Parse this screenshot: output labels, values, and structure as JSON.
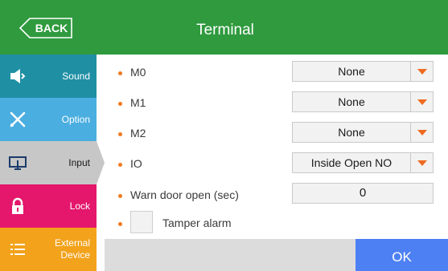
{
  "header": {
    "back_label": "BACK",
    "title": "Terminal"
  },
  "sidebar": {
    "items": [
      {
        "label": "Sound",
        "icon": "speaker-icon"
      },
      {
        "label": "Option",
        "icon": "tools-icon"
      },
      {
        "label": "Input",
        "icon": "monitor-icon",
        "selected": true
      },
      {
        "label": "Lock",
        "icon": "lock-icon"
      },
      {
        "label": "External Device",
        "icon": "list-icon"
      }
    ]
  },
  "form": {
    "m0": {
      "label": "M0",
      "value": "None"
    },
    "m1": {
      "label": "M1",
      "value": "None"
    },
    "m2": {
      "label": "M2",
      "value": "None"
    },
    "io": {
      "label": "IO",
      "value": "Inside Open NO"
    },
    "warn_door": {
      "label": "Warn door open (sec)",
      "value": "0"
    },
    "tamper": {
      "label": "Tamper alarm",
      "checked": false
    }
  },
  "footer": {
    "ok_label": "OK"
  },
  "colors": {
    "header": "#2f9a3e",
    "sound": "#1f8fa4",
    "option": "#4aaee0",
    "input": "#c7c7c7",
    "lock": "#e4176c",
    "external": "#f2a21b",
    "ok": "#4d80f3",
    "accent": "#f07a20"
  }
}
